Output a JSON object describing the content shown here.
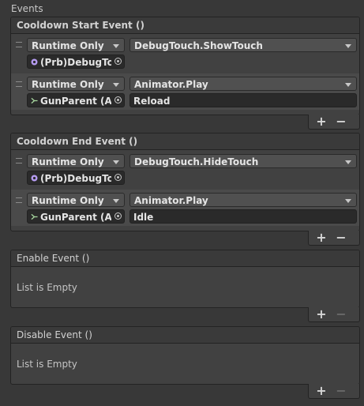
{
  "section_title": "Events",
  "events": [
    {
      "title": "Cooldown Start Event ()",
      "entries": [
        {
          "mode": "Runtime Only",
          "function": "DebugTouch.ShowTouch",
          "target": "(Prb)DebugTou",
          "target_icon": "prefab-icon",
          "argument": ""
        },
        {
          "mode": "Runtime Only",
          "function": "Animator.Play",
          "target": "GunParent (Ani",
          "target_icon": "animator-icon",
          "argument": "Reload"
        }
      ],
      "add_label": "+",
      "remove_label": "−"
    },
    {
      "title": "Cooldown End Event ()",
      "entries": [
        {
          "mode": "Runtime Only",
          "function": "DebugTouch.HideTouch",
          "target": "(Prb)DebugTou",
          "target_icon": "prefab-icon",
          "argument": ""
        },
        {
          "mode": "Runtime Only",
          "function": "Animator.Play",
          "target": "GunParent (Ani",
          "target_icon": "animator-icon",
          "argument": "Idle"
        }
      ],
      "add_label": "+",
      "remove_label": "−"
    },
    {
      "title": "Enable Event ()",
      "empty_text": "List is Empty",
      "add_label": "+",
      "remove_label": "−"
    },
    {
      "title": "Disable Event ()",
      "empty_text": "List is Empty",
      "add_label": "+",
      "remove_label": "−"
    }
  ],
  "colors": {
    "prefab_icon": "#b59bf0",
    "animator_icon": "#a8d8a0"
  }
}
